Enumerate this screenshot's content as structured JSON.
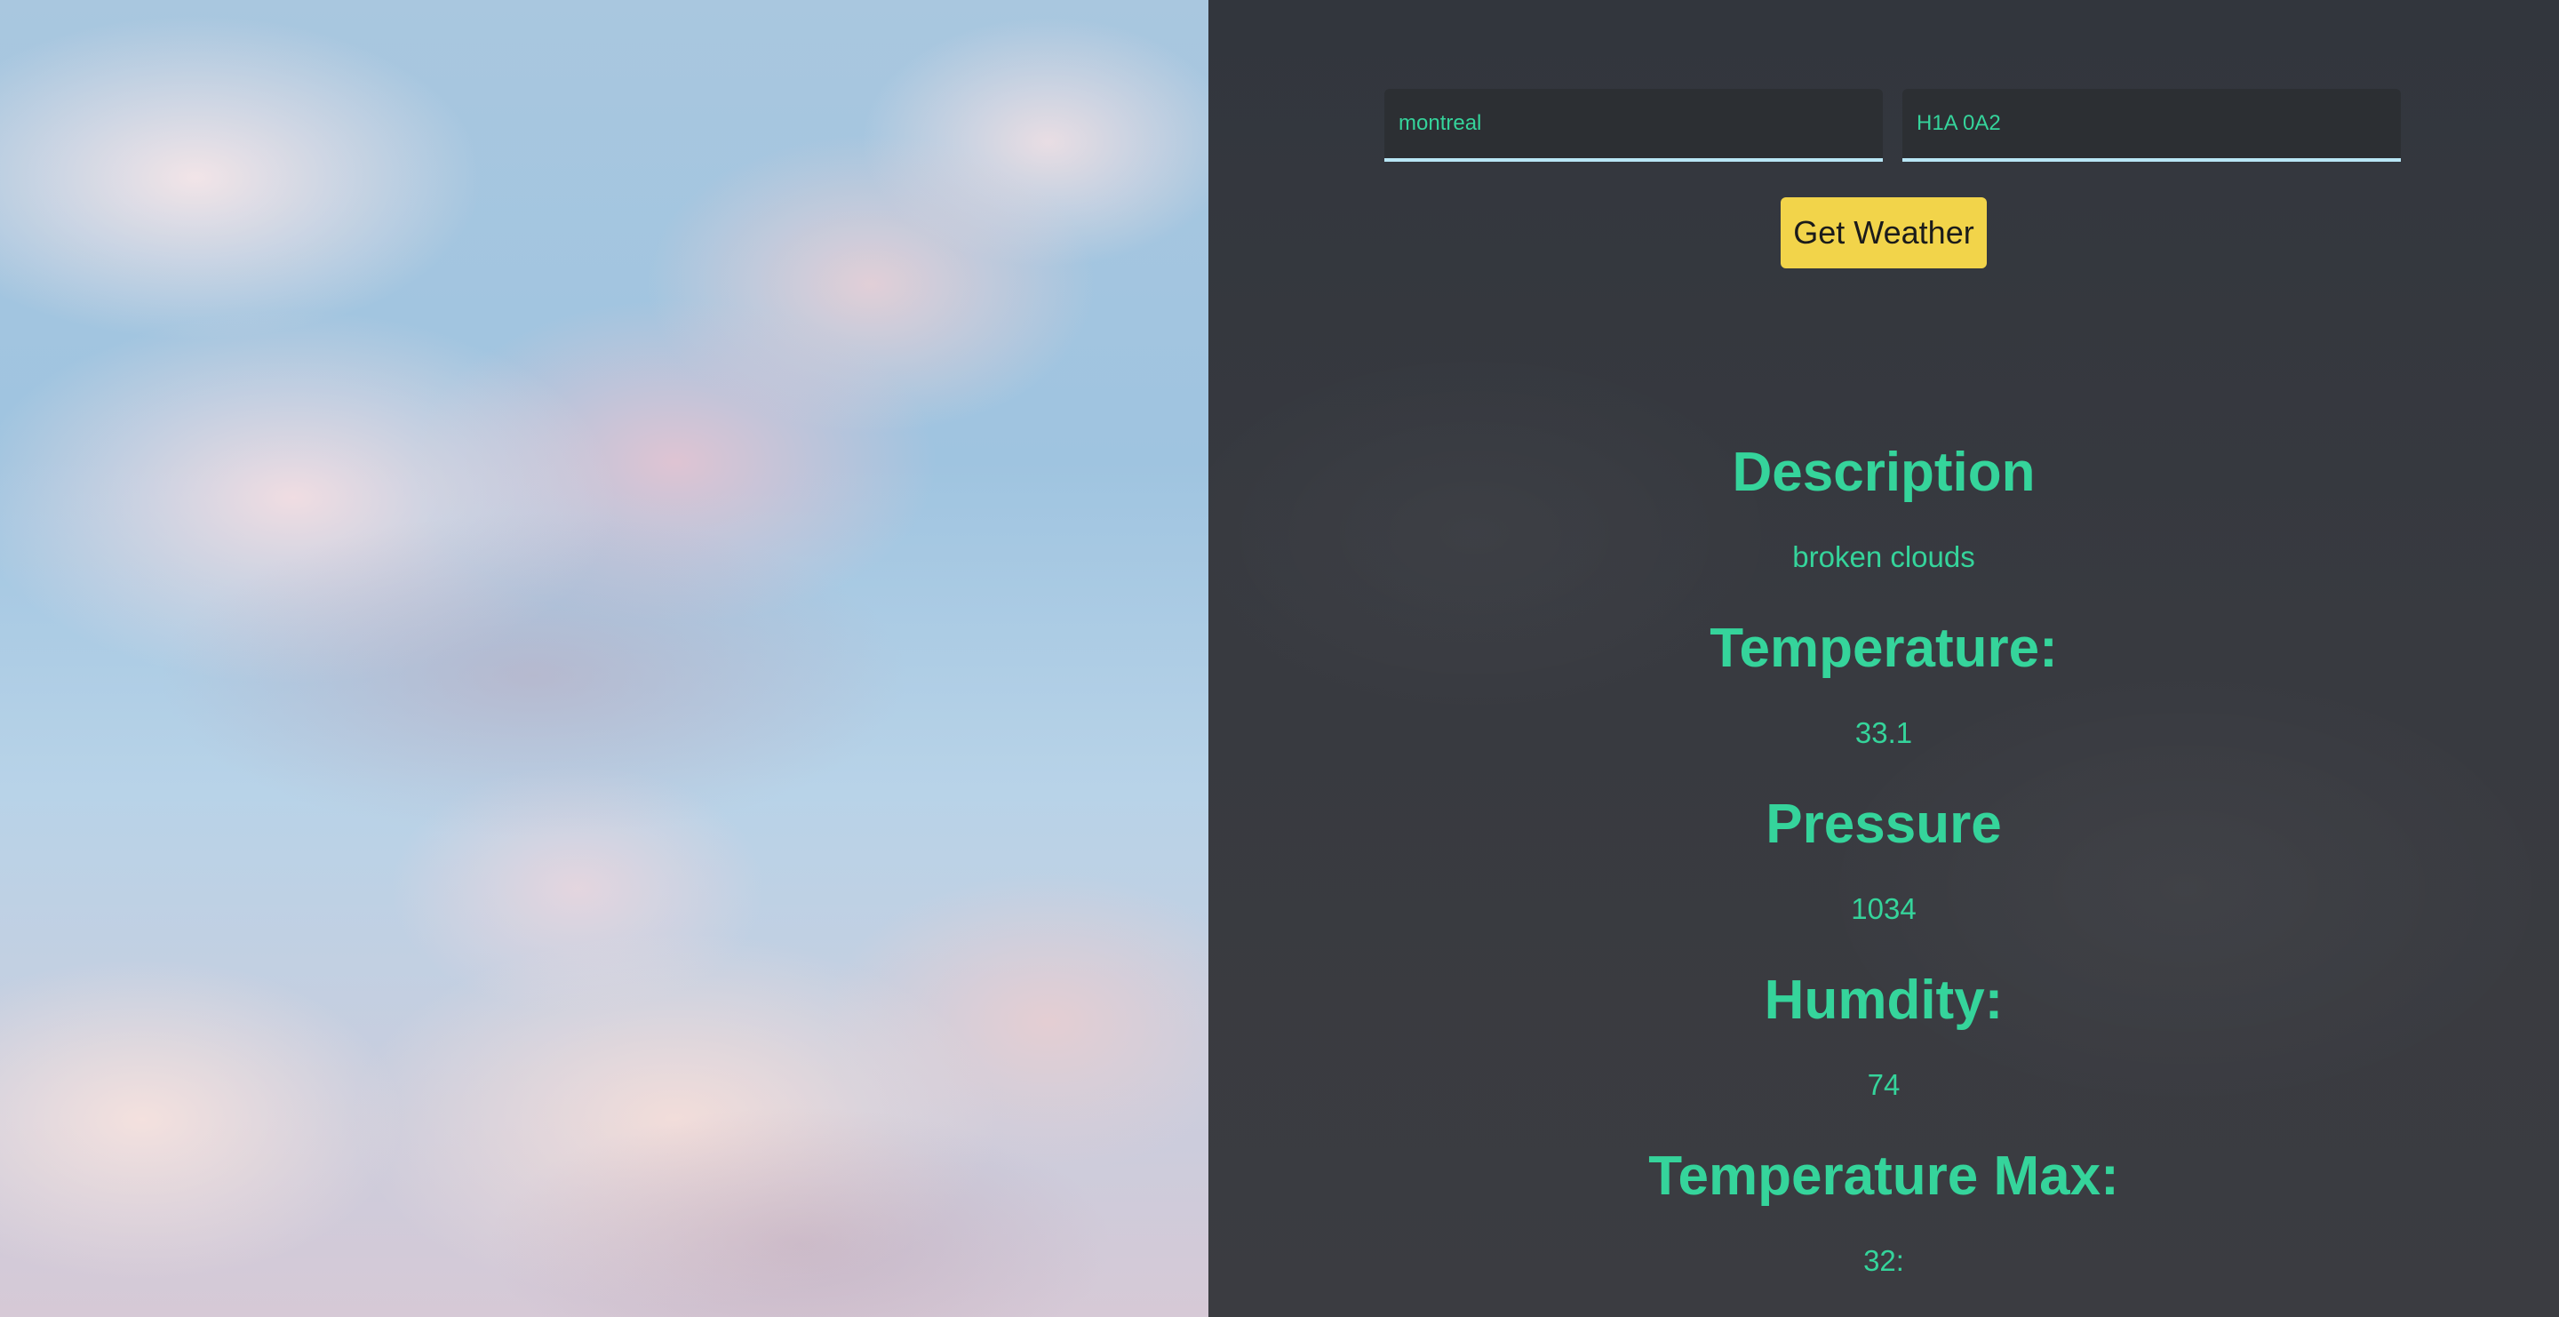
{
  "form": {
    "city_value": "montreal",
    "postal_value": "H1A 0A2",
    "submit_label": "Get Weather"
  },
  "results": [
    {
      "label": "Description",
      "value": "broken clouds"
    },
    {
      "label": "Temperature:",
      "value": "33.1"
    },
    {
      "label": "Pressure",
      "value": "1034"
    },
    {
      "label": "Humdity:",
      "value": "74"
    },
    {
      "label": "Temperature Max:",
      "value": "32:"
    }
  ],
  "colors": {
    "accent_text": "#35d49b",
    "button": "#f2d44a",
    "panel_bg": "#383a40",
    "input_underline": "#b8e6f5"
  }
}
